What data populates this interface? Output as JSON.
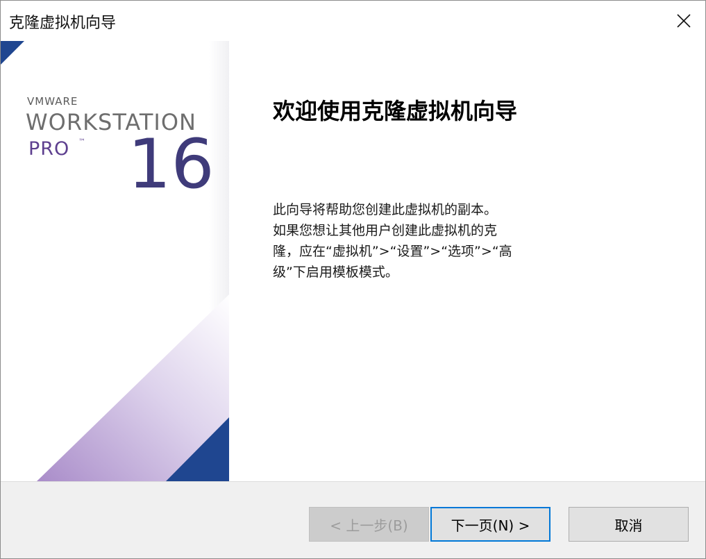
{
  "window": {
    "title": "克隆虚拟机向导"
  },
  "titlebar": {
    "close_icon": "close-icon"
  },
  "brand": {
    "vmware": "VMWARE",
    "product": "WORKSTATION",
    "edition": "PRO",
    "trademark": "™",
    "version": "16",
    "colors": {
      "navy": "#1f4690",
      "purple": "#5d3f8f",
      "gray": "#6e6e6e",
      "lavender": "#b9a3d6"
    }
  },
  "main": {
    "heading": "欢迎使用克隆虚拟机向导",
    "description_lines": [
      "此向导将帮助您创建此虚拟机的副本。",
      "如果您想让其他用户创建此虚拟机的克",
      "隆，应在“虚拟机”>“设置”>“选项”>“高",
      "级”下启用模板模式。"
    ]
  },
  "footer": {
    "back_label": "< 上一步(B)",
    "next_label": "下一页(N) >",
    "cancel_label": "取消",
    "back_enabled": false,
    "accent_color": "#0078d7"
  }
}
